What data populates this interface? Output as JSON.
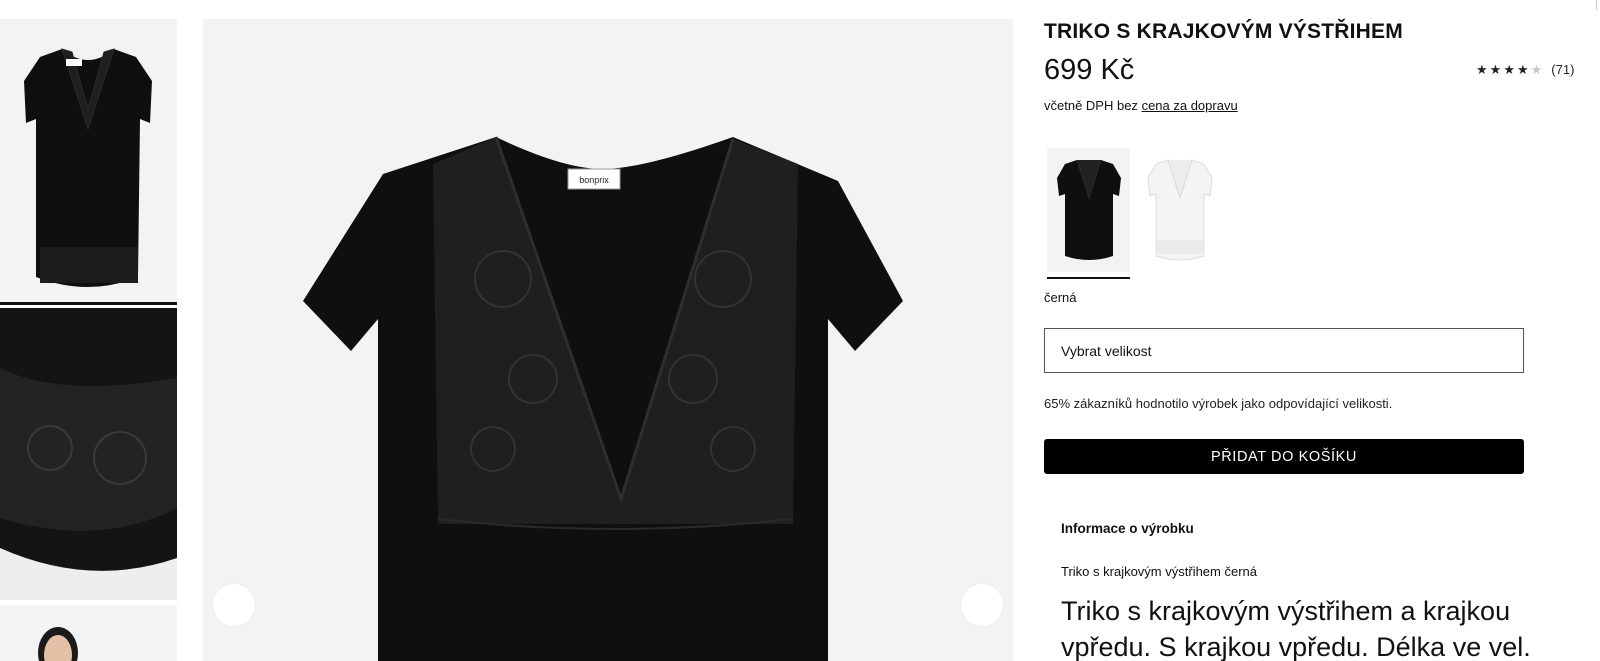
{
  "product": {
    "title": "TRIKO S KRAJKOVÝM VÝSTŘIHEM",
    "price": "699 Kč",
    "rating": {
      "stars": 4,
      "max": 5,
      "count_label": "(71)"
    },
    "vat_prefix": "včetně DPH bez",
    "vat_link": "cena za dopravu",
    "color_name": "černá",
    "size_select": "Vybrat velikost",
    "fit_note": "65% zákazníků hodnotilo výrobek jako odpovídající velikosti.",
    "add_to_cart": "PŘIDAT DO KOŠÍKU"
  },
  "details": {
    "heading": "Informace o výrobku",
    "subtitle": "Triko s krajkovým výstřihem černá",
    "description": "Triko s krajkovým výstřihem a krajkou vpředu. S krajkou vpředu. Délka ve vel."
  },
  "brand_tag": "bonprix",
  "colors": {
    "shirt": "#0f0f0f",
    "lace": "#1f1f1f",
    "background": "#f3f3f3",
    "accent": "#000000"
  },
  "icons": {
    "star": "star-icon",
    "prev": "chevron-left-icon",
    "next": "chevron-right-icon"
  }
}
